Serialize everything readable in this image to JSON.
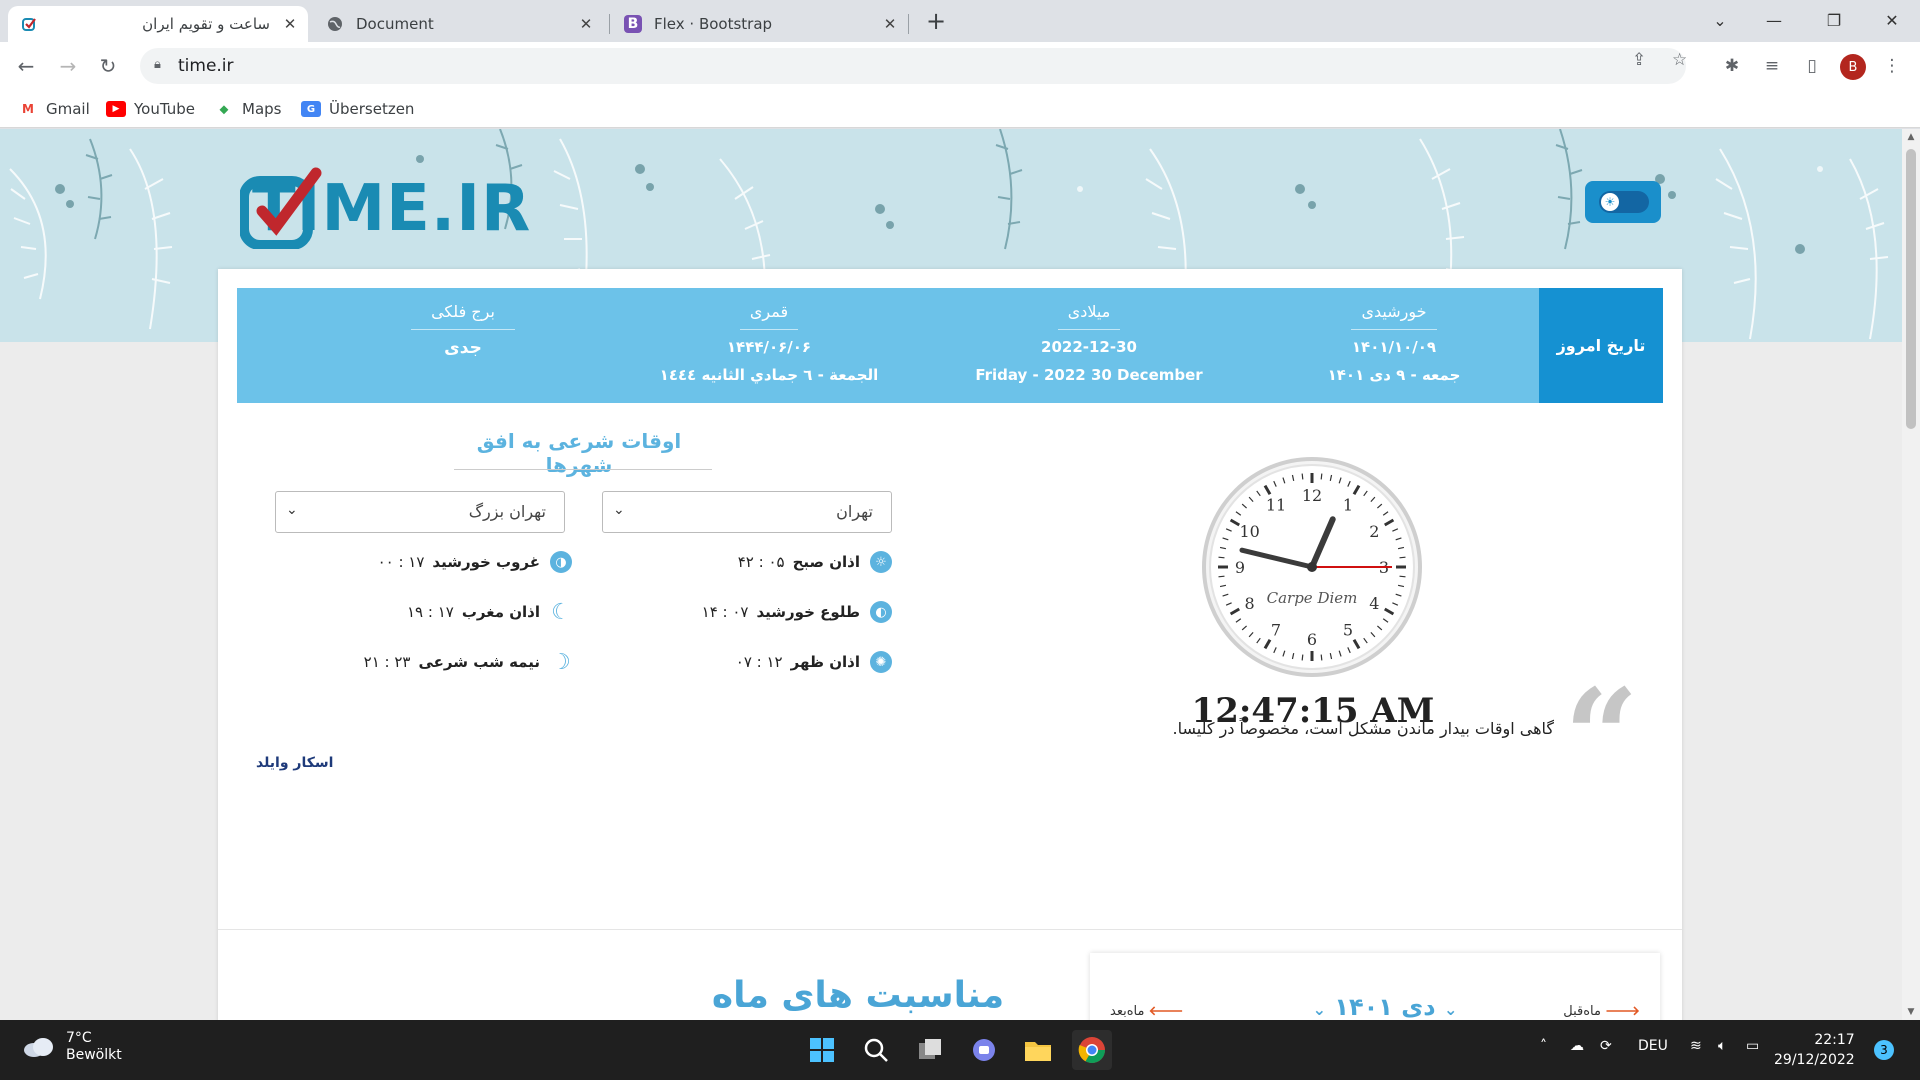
{
  "browser": {
    "tabs": [
      {
        "title": "ساعت و تقویم ایران",
        "active": true
      },
      {
        "title": "Document",
        "active": false
      },
      {
        "title": "Flex · Bootstrap",
        "active": false
      }
    ],
    "url": "time.ir",
    "profile_initial": "B",
    "bookmarks": [
      "Gmail",
      "YouTube",
      "Maps",
      "Übersetzen"
    ]
  },
  "site": {
    "logo_text": "TIME.IR",
    "today_label": "تاریخ امروز",
    "dates": [
      {
        "heading": "خورشیدی",
        "line1": "۱۴۰۱/۱۰/۰۹",
        "line2": "جمعه - ۹ دی ۱۴۰۱"
      },
      {
        "heading": "میلادی",
        "line1": "2022-12-30",
        "line2": "Friday - 2022 30 December"
      },
      {
        "heading": "قمری",
        "line1": "۱۴۴۴/۰۶/۰۶",
        "line2": "الجمعة - ٦ جمادي الثانيه ١٤٤٤"
      },
      {
        "heading": "برج فلکی",
        "line1": "جدی",
        "line2": ""
      }
    ],
    "clock": {
      "brand": "Carpe Diem",
      "time": "12:47:15 AM",
      "hours": 12,
      "minutes": 47,
      "seconds": 15
    },
    "prayer": {
      "title": "اوقات شرعی به افق شهرها",
      "city_select": "تهران",
      "region_select": "تهران بزرگ",
      "times_right": [
        {
          "label": "اذان صبح",
          "value": "۰۵ : ۴۲",
          "icon": "sun-outline-icon"
        },
        {
          "label": "طلوع خورشید",
          "value": "۰۷ : ۱۴",
          "icon": "sunrise-icon"
        },
        {
          "label": "اذان ظهر",
          "value": "۱۲ : ۰۷",
          "icon": "sun-icon"
        }
      ],
      "times_left": [
        {
          "label": "غروب خورشید",
          "value": "۱۷ : ۰۰",
          "icon": "sunset-icon"
        },
        {
          "label": "اذان مغرب",
          "value": "۱۷ : ۱۹",
          "icon": "moon-icon"
        },
        {
          "label": "نیمه شب شرعی",
          "value": "۲۳ : ۲۱",
          "icon": "crescent-icon"
        }
      ]
    },
    "quote": {
      "text": "گاهی اوقات بیدار ماندن مشکل است، مخصوصاً در کلیسا.",
      "author": "اسکار وایلد"
    },
    "calendar": {
      "prev": "ماه‌قبل",
      "next": "ماه‌بعد",
      "month": "دی ۱۴۰۱"
    },
    "events_title": "مناسبت های ماه دی"
  },
  "taskbar": {
    "temp": "7°C",
    "weather": "Bewölkt",
    "lang": "DEU",
    "time": "22:17",
    "date": "29/12/2022",
    "notifications": "3"
  },
  "colors": {
    "accent": "#1591d2",
    "datebar": "#6cc2e9",
    "title_blue": "#4aa5d6"
  }
}
